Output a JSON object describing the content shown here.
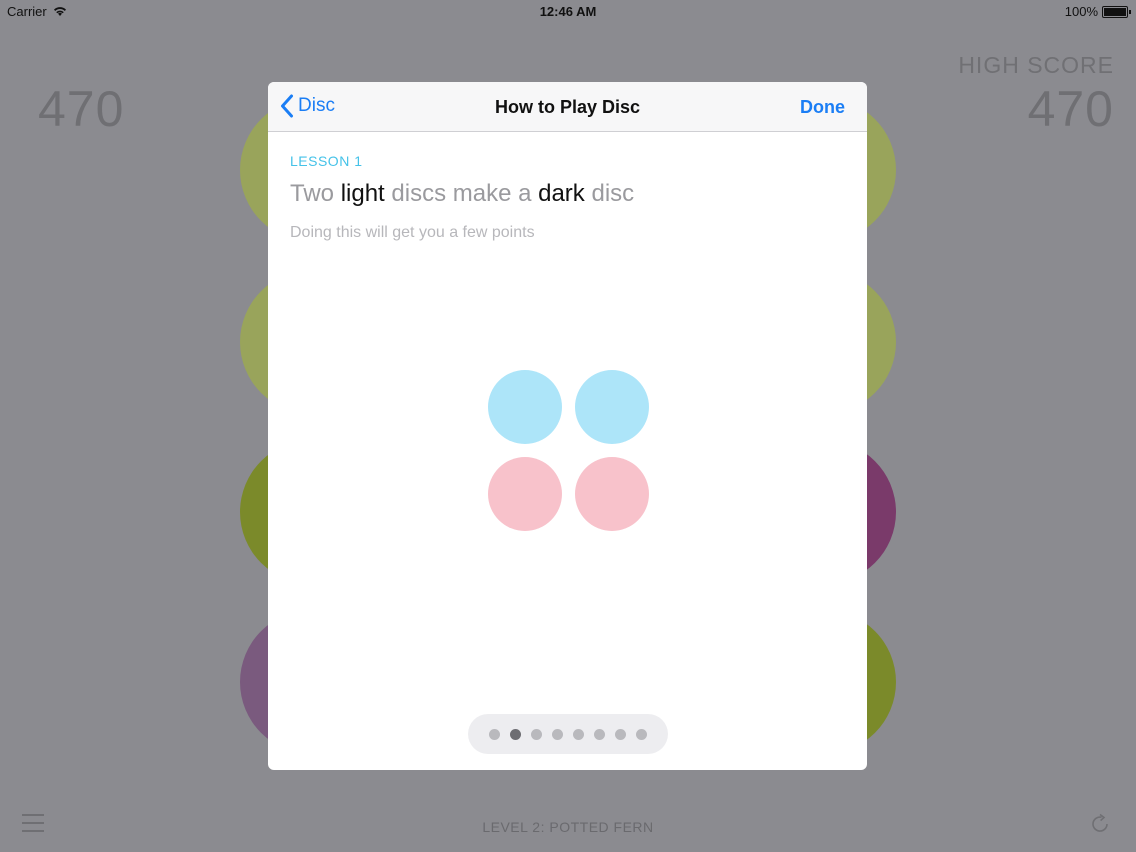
{
  "status_bar": {
    "carrier": "Carrier",
    "time": "12:46 AM",
    "battery": "100%"
  },
  "game": {
    "score": "470",
    "high_score_label": "HIGH SCORE",
    "high_score": "470",
    "level": "LEVEL 2: POTTED FERN"
  },
  "modal": {
    "back_label": "Disc",
    "title": "How to Play Disc",
    "done_label": "Done",
    "lesson_label": "LESSON 1",
    "lesson_title": {
      "part1": "Two ",
      "light": "light",
      "part2": " discs make a ",
      "dark": "dark",
      "part3": " disc"
    },
    "lesson_subtitle": "Doing this will get you a few points",
    "demo_colors": {
      "light_blue": "#ade5f9",
      "light_pink": "#f8c2cb"
    },
    "pages": {
      "total": 8,
      "current": 2
    }
  },
  "colors": {
    "accent": "#1b7ef5",
    "lesson_accent": "#45c2e8",
    "bg_green_light": "#99a45b",
    "bg_green": "#7b8a2a",
    "bg_purple": "#7a5a7e",
    "bg_magenta": "#7a3a6a"
  }
}
